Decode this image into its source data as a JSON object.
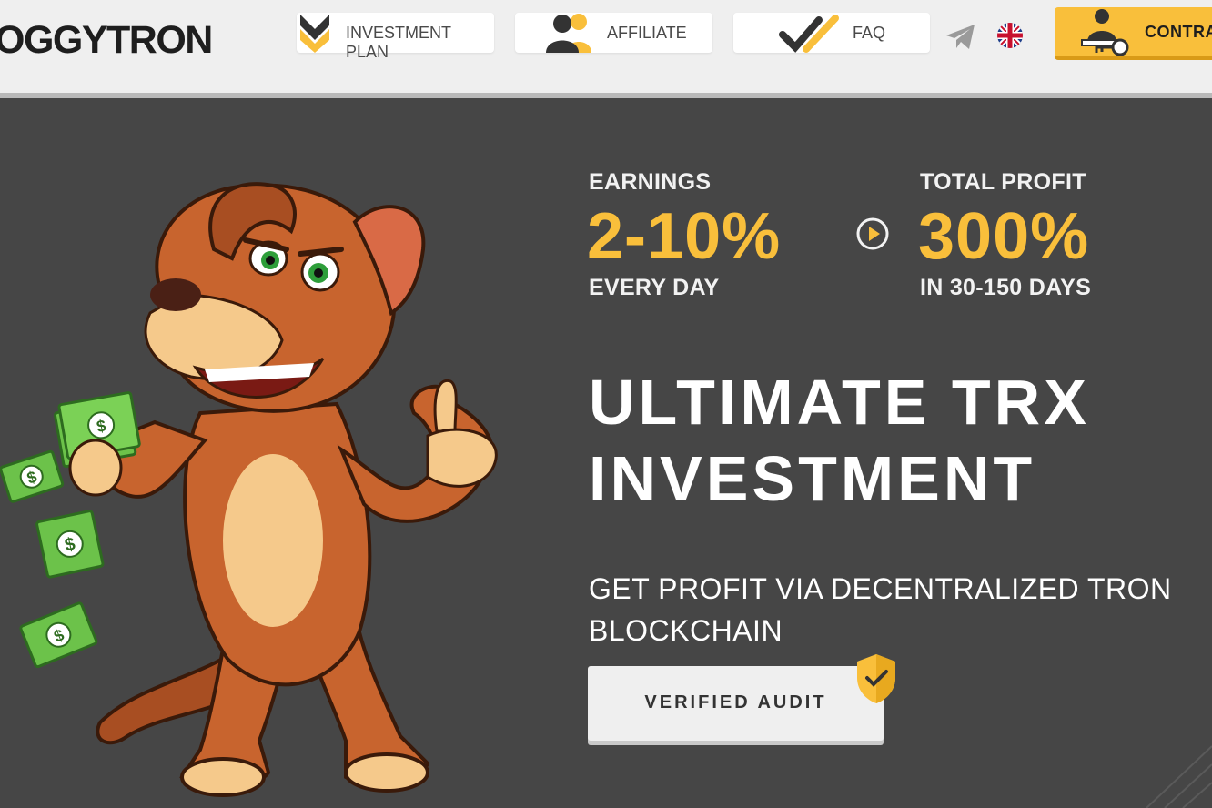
{
  "brand": {
    "logo_text": "OGGYTRON"
  },
  "nav": {
    "investment_plan": "INVESTMENT PLAN",
    "affiliate": "AFFILIATE",
    "faq": "FAQ",
    "contract": "CONTRA"
  },
  "hero": {
    "earnings_label": "EARNINGS",
    "earnings_value": "2-10%",
    "earnings_period": "EVERY DAY",
    "profit_label": "TOTAL PROFIT",
    "profit_value": "300%",
    "profit_period": "IN 30-150 DAYS",
    "headline_line1": "ULTIMATE TRX",
    "headline_line2": "INVESTMENT",
    "subtitle_line1": "GET PROFIT VIA DECENTRALIZED TRON",
    "subtitle_line2": "BLOCKCHAIN",
    "audit_label": "VERIFIED AUDIT"
  },
  "icons": {
    "investment": "chevron-down-icon",
    "affiliate": "users-icon",
    "faq": "check-icon",
    "telegram": "telegram-icon",
    "language": "uk-flag-icon",
    "contract": "contract-key-icon",
    "play": "play-icon",
    "shield": "shield-check-icon"
  },
  "colors": {
    "accent": "#f9bf3b",
    "background": "#464646",
    "header": "#efefef",
    "text": "#ffffff"
  }
}
